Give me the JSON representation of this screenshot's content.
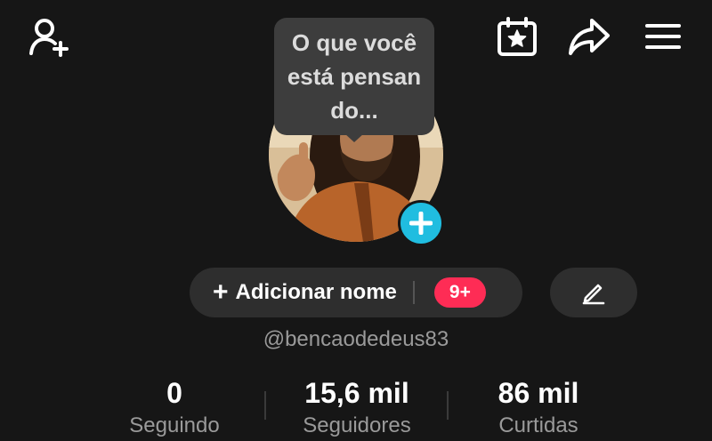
{
  "header": {
    "add_friend_icon": "person-plus-icon",
    "calendar_icon": "calendar-star-icon",
    "share_icon": "share-arrow-icon",
    "menu_icon": "hamburger-menu-icon"
  },
  "bubble": {
    "text": "O que você está pensando..."
  },
  "profile": {
    "add_name_plus": "+",
    "add_name_label": "Adicionar nome",
    "badge": "9+",
    "edit_icon": "pencil-icon",
    "username": "@bencaodedeus83"
  },
  "stats": [
    {
      "value": "0",
      "label": "Seguindo"
    },
    {
      "value": "15,6 mil",
      "label": "Seguidores"
    },
    {
      "value": "86 mil",
      "label": "Curtidas"
    }
  ],
  "colors": {
    "background": "#161616",
    "accent_blue": "#20bde0",
    "badge_red": "#fe2c55",
    "pill": "#2e2e2e",
    "muted_text": "#9a9a9a"
  }
}
